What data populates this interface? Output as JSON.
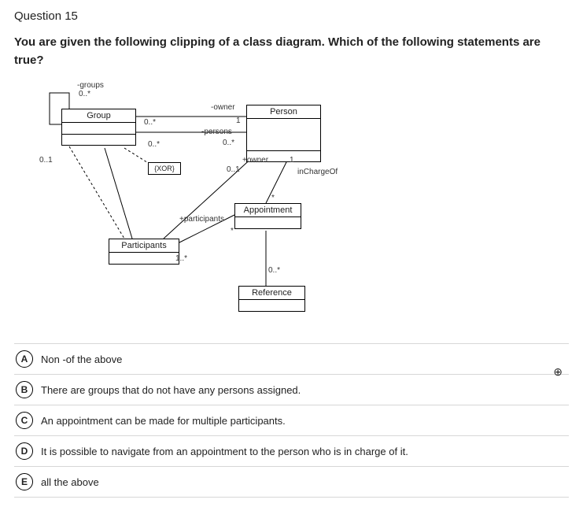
{
  "question": {
    "number_label": "Question 15",
    "prompt": "You are given the following clipping of a class diagram. Which of the following statements are true?"
  },
  "diagram": {
    "boxes": {
      "group": "Group",
      "person": "Person",
      "participants": "Participants",
      "appointment": "Appointment",
      "reference": "Reference",
      "xor": "{XOR}"
    },
    "labels": {
      "groups_role": "-groups",
      "groups_mult": "0..*",
      "owner_role": "-owner",
      "owner_mult_src": "0..*",
      "owner_mult_tgt": "1",
      "persons_role": "-persons",
      "persons_mult_src": "0..*",
      "persons_mult_tgt": "0..*",
      "a01": "0..1",
      "owner2_role": "+owner",
      "owner2_mult": "0..1",
      "owner2_one": "1",
      "incharge": "inChargeOf",
      "participants_role": "+participants",
      "participants_mult": "1..*",
      "assoc_appt_mult": "*",
      "ref_mult": "0..*",
      "assoc_star": "*"
    }
  },
  "answers": [
    {
      "letter": "A",
      "text": "Non -of the above"
    },
    {
      "letter": "B",
      "text": "There are groups that do not have any persons assigned."
    },
    {
      "letter": "C",
      "text": "An appointment can be made for multiple participants."
    },
    {
      "letter": "D",
      "text": "It is possible to navigate from an appointment to the person who is in charge of it."
    },
    {
      "letter": "E",
      "text": "all the above"
    }
  ],
  "icons": {
    "zoom": "⊕"
  }
}
